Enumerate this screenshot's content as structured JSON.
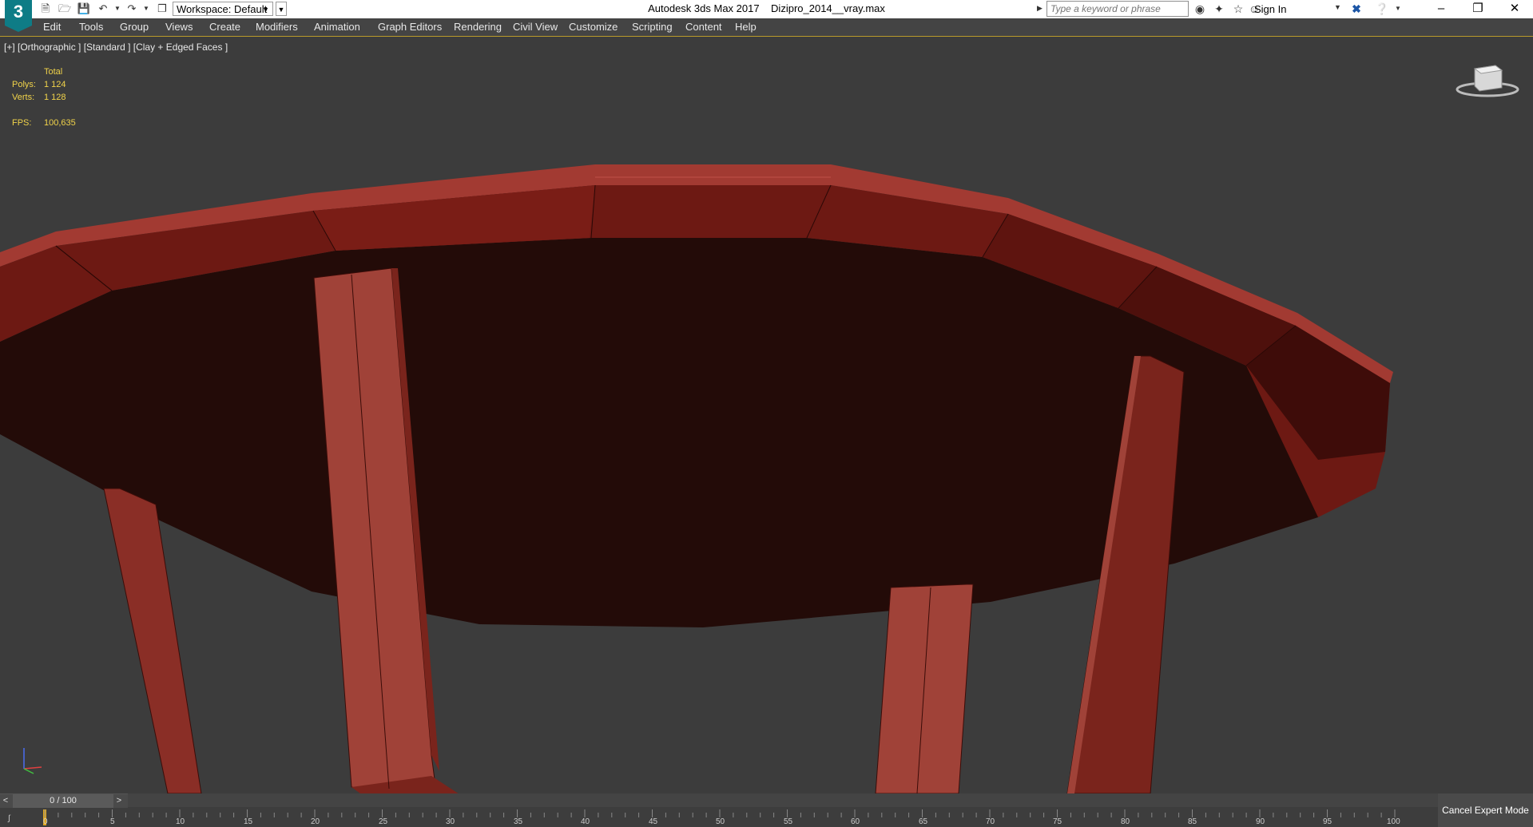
{
  "titlebar": {
    "logo": "3",
    "workspace_label": "Workspace: Default",
    "app_title": "Autodesk 3ds Max 2017",
    "file_name": "Dizipro_2014__vray.max",
    "search_placeholder": "Type a keyword or phrase",
    "sign_in": "Sign In",
    "icons": [
      "new-file-icon",
      "open-file-icon",
      "save-icon",
      "undo-icon",
      "redo-icon",
      "project-icon",
      "binoculars-icon",
      "settings-icon",
      "star-icon",
      "user-icon",
      "exchange-icon",
      "help-icon"
    ]
  },
  "menu": [
    "Edit",
    "Tools",
    "Group",
    "Views",
    "Create",
    "Modifiers",
    "Animation",
    "Graph Editors",
    "Rendering",
    "Civil View",
    "Customize",
    "Scripting",
    "Content",
    "Help"
  ],
  "viewport": {
    "label": "[+] [Orthographic ] [Standard ] [Clay + Edged Faces ]",
    "stats": {
      "total_header": "Total",
      "polys_label": "Polys:",
      "polys_value": "1 124",
      "verts_label": "Verts:",
      "verts_value": "1 128",
      "fps_label": "FPS:",
      "fps_value": "100,635"
    },
    "colors": {
      "background": "#3c3c3c",
      "object": "#8b2a22",
      "underside": "#230b08",
      "stats_text": "#f1d34a"
    }
  },
  "timeline": {
    "slider_value": "0 / 100",
    "ticks": [
      "0",
      "5",
      "10",
      "15",
      "20",
      "25",
      "30",
      "35",
      "40",
      "45",
      "50",
      "55",
      "60",
      "65",
      "70",
      "75",
      "80",
      "85",
      "90",
      "95",
      "100"
    ]
  },
  "status": {
    "cancel_expert": "Cancel Expert Mode"
  }
}
